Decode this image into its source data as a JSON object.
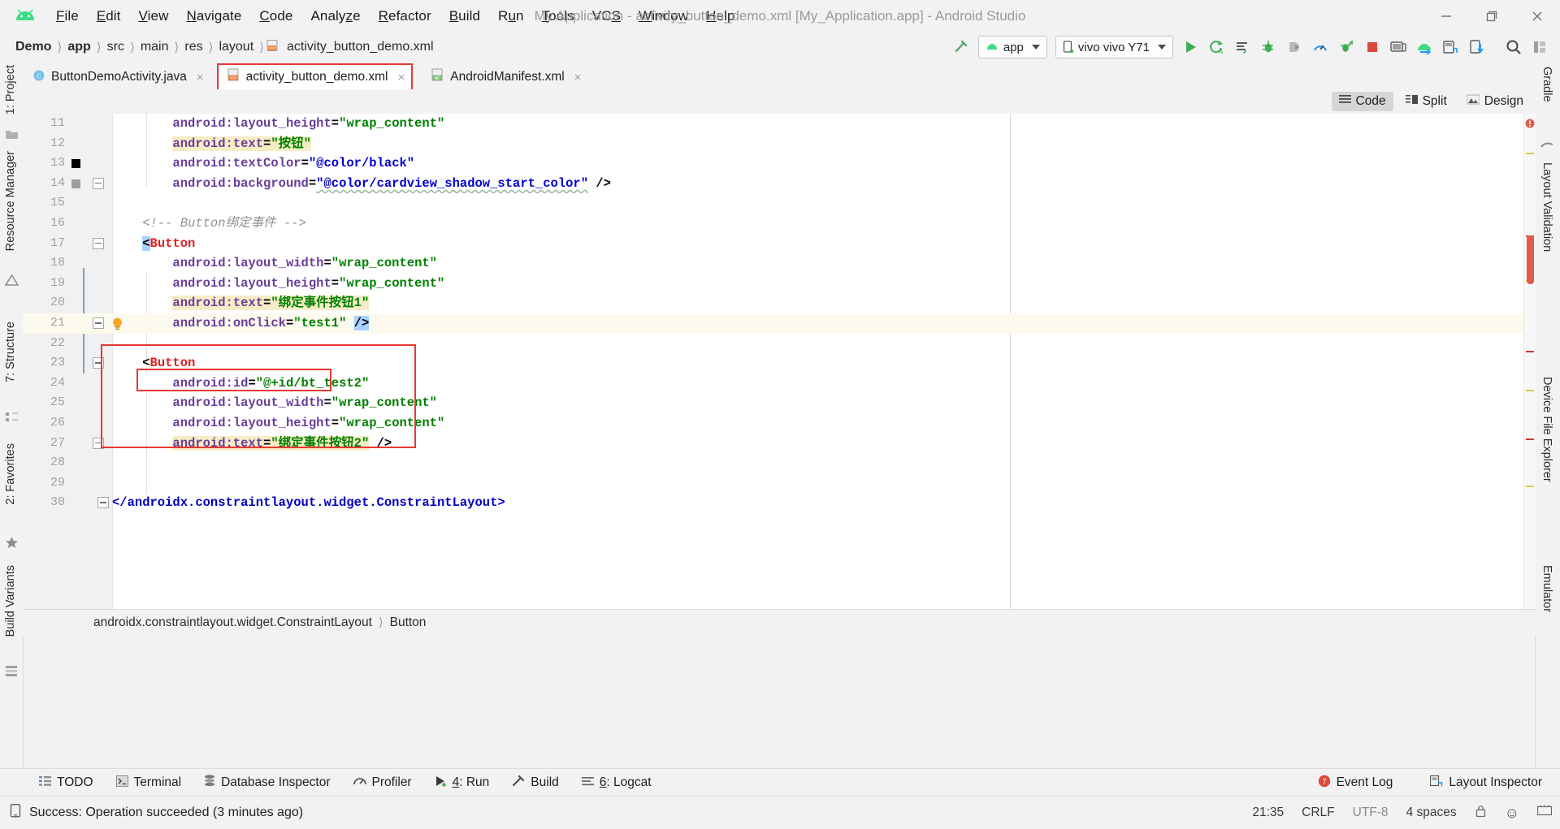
{
  "window": {
    "title": "My Application - activity_button_demo.xml [My_Application.app] - Android Studio",
    "minimize": "minimize-button",
    "maximize": "maximize-button",
    "close": "close-button"
  },
  "menu": {
    "items": [
      {
        "label": "File",
        "mnemonic": "F"
      },
      {
        "label": "Edit",
        "mnemonic": "E"
      },
      {
        "label": "View",
        "mnemonic": "V"
      },
      {
        "label": "Navigate",
        "mnemonic": "N"
      },
      {
        "label": "Code",
        "mnemonic": "C"
      },
      {
        "label": "Analyze",
        "mnemonic": "z"
      },
      {
        "label": "Refactor",
        "mnemonic": "R"
      },
      {
        "label": "Build",
        "mnemonic": "B"
      },
      {
        "label": "Run",
        "mnemonic": "u"
      },
      {
        "label": "Tools",
        "mnemonic": "T"
      },
      {
        "label": "VCS",
        "mnemonic": "S"
      },
      {
        "label": "Window",
        "mnemonic": "W"
      },
      {
        "label": "Help",
        "mnemonic": "H"
      }
    ]
  },
  "navbar": {
    "breadcrumbs": [
      "Demo",
      "app",
      "src",
      "main",
      "res",
      "layout",
      "activity_button_demo.xml"
    ],
    "separator": "〉",
    "run_config": "app",
    "device": "vivo vivo Y71",
    "toolbar_icons": [
      "run-button",
      "apply-changes-button",
      "apply-code-changes-button",
      "debug-button",
      "attach-debugger-button",
      "profiler-button",
      "run-with-coverage-button",
      "stop-button",
      "avd-manager-button",
      "sdk-manager-button",
      "layout-inspector-button",
      "device-file-explorer-button",
      "search-everywhere-button",
      "project-structure-button"
    ]
  },
  "left_tool_window": {
    "items": [
      {
        "label": "1: Project",
        "name": "project"
      },
      {
        "label": "Resource Manager",
        "name": "resource-manager"
      },
      {
        "label": "7: Structure",
        "name": "structure"
      },
      {
        "label": "2: Favorites",
        "name": "favorites"
      },
      {
        "label": "Build Variants",
        "name": "build-variants"
      }
    ]
  },
  "right_tool_window": {
    "items": [
      {
        "label": "Gradle",
        "name": "gradle"
      },
      {
        "label": "Layout Validation",
        "name": "layout-validation"
      },
      {
        "label": "Device File Explorer",
        "name": "device-file-explorer"
      },
      {
        "label": "Emulator",
        "name": "emulator"
      }
    ]
  },
  "tabs": [
    {
      "label": "ButtonDemoActivity.java",
      "icon": "java-class-icon",
      "active": false,
      "close": "×"
    },
    {
      "label": "activity_button_demo.xml",
      "icon": "layout-xml-icon",
      "active": true,
      "close": "×",
      "highlighted": true
    },
    {
      "label": "AndroidManifest.xml",
      "icon": "manifest-xml-icon",
      "active": false,
      "close": "×"
    }
  ],
  "view_modes": [
    {
      "label": "Code",
      "icon": "code-view-icon",
      "selected": true
    },
    {
      "label": "Split",
      "icon": "split-view-icon",
      "selected": false
    },
    {
      "label": "Design",
      "icon": "design-view-icon",
      "selected": false
    }
  ],
  "editor": {
    "file": "activity_button_demo.xml",
    "first_line": 11,
    "current_line": 21,
    "lines": [
      {
        "n": 11,
        "text": "        android:layout_height=\"wrap_content\""
      },
      {
        "n": 12,
        "text": "        android:text=\"按钮\""
      },
      {
        "n": 13,
        "text": "        android:textColor=\"@color/black\""
      },
      {
        "n": 14,
        "text": "        android:background=\"@color/cardview_shadow_start_color\" />"
      },
      {
        "n": 15,
        "text": ""
      },
      {
        "n": 16,
        "text": "    <!-- Button绑定事件 -->"
      },
      {
        "n": 17,
        "text": "    <Button"
      },
      {
        "n": 18,
        "text": "        android:layout_width=\"wrap_content\""
      },
      {
        "n": 19,
        "text": "        android:layout_height=\"wrap_content\""
      },
      {
        "n": 20,
        "text": "        android:text=\"绑定事件按钮1\""
      },
      {
        "n": 21,
        "text": "        android:onClick=\"test1\" />"
      },
      {
        "n": 22,
        "text": ""
      },
      {
        "n": 23,
        "text": "    <Button"
      },
      {
        "n": 24,
        "text": "        android:id=\"@+id/bt_test2\""
      },
      {
        "n": 25,
        "text": "        android:layout_width=\"wrap_content\""
      },
      {
        "n": 26,
        "text": "        android:layout_height=\"wrap_content\""
      },
      {
        "n": 27,
        "text": "        android:text=\"绑定事件按钮2\" />"
      },
      {
        "n": 28,
        "text": ""
      },
      {
        "n": 29,
        "text": ""
      },
      {
        "n": 30,
        "text": "</androidx.constraintlayout.widget.ConstraintLayout>"
      }
    ],
    "tokens": {
      "l11": {
        "attr": "android:layout_height",
        "value": "\"wrap_content\""
      },
      "l12": {
        "attr": "android:text",
        "value": "\"按钮\""
      },
      "l13": {
        "attr": "android:textColor",
        "value": "\"@color/black\""
      },
      "l14": {
        "attr": "android:background",
        "value": "\"@color/cardview_shadow_start_color\"",
        "tail": " />"
      },
      "l16": {
        "comment": "<!-- Button绑定事件 -->"
      },
      "l17": {
        "open": "<",
        "tag": "Button"
      },
      "l18": {
        "attr": "android:layout_width",
        "value": "\"wrap_content\""
      },
      "l19": {
        "attr": "android:layout_height",
        "value": "\"wrap_content\""
      },
      "l20": {
        "attr": "android:text",
        "value": "\"绑定事件按钮1\""
      },
      "l21": {
        "attr": "android:onClick",
        "value": "\"test1\"",
        "tail": "/>"
      },
      "l23": {
        "open": "<",
        "tag": "Button"
      },
      "l24": {
        "attr": "android:id",
        "value": "\"@+id/bt_test2\""
      },
      "l25": {
        "attr": "android:layout_width",
        "value": "\"wrap_content\""
      },
      "l26": {
        "attr": "android:layout_height",
        "value": "\"wrap_content\""
      },
      "l27": {
        "attr": "android:text",
        "value": "\"绑定事件按钮2\"",
        "tail": " />"
      },
      "l30": {
        "close": "</androidx.constraintlayout.widget.ConstraintLayout>"
      }
    },
    "annotations": [
      {
        "name": "button2-block-highlight",
        "color": "#e53935"
      },
      {
        "name": "android-id-attribute-highlight",
        "color": "#e53935"
      }
    ],
    "inspection_status": "error"
  },
  "editor_breadcrumbs": {
    "items": [
      "androidx.constraintlayout.widget.ConstraintLayout",
      "Button"
    ],
    "separator": "〉"
  },
  "bottom_tool_windows": [
    {
      "label": "TODO",
      "icon": "todo-icon",
      "mnemonic": ""
    },
    {
      "label": "Terminal",
      "icon": "terminal-icon",
      "mnemonic": ""
    },
    {
      "label": "Database Inspector",
      "icon": "database-icon",
      "mnemonic": ""
    },
    {
      "label": "Profiler",
      "icon": "profiler-icon",
      "mnemonic": ""
    },
    {
      "label": "4: Run",
      "icon": "run-icon",
      "mnemonic": "4"
    },
    {
      "label": "Build",
      "icon": "build-icon",
      "mnemonic": ""
    },
    {
      "label": "6: Logcat",
      "icon": "logcat-icon",
      "mnemonic": "6"
    }
  ],
  "bottom_right": [
    {
      "label": "Event Log",
      "icon": "event-log-icon",
      "badge": "7"
    },
    {
      "label": "Layout Inspector",
      "icon": "layout-inspector-icon"
    }
  ],
  "status_bar": {
    "message": "Success: Operation succeeded (3 minutes ago)",
    "message_icon": "device-icon",
    "caret": "21:35",
    "line_separator": "CRLF",
    "encoding": "UTF-8",
    "indent": "4 spaces",
    "lock_icon": "lock-icon",
    "face_icon": "☺",
    "memory_icon": "memory-icon"
  },
  "colors": {
    "accent_red": "#e53935",
    "tag": "#e02020",
    "attribute": "#6a3d9a",
    "string_value": "#008000",
    "resource_value": "#0000d0",
    "comment": "#909090",
    "current_line_bg": "#fcfaef",
    "search_hl_bg": "#f6edc6",
    "selection_bg": "#a6d2ff",
    "chrome_bg": "#f2f2f2",
    "editor_bg": "#ffffff",
    "green": "#3ddc84"
  }
}
